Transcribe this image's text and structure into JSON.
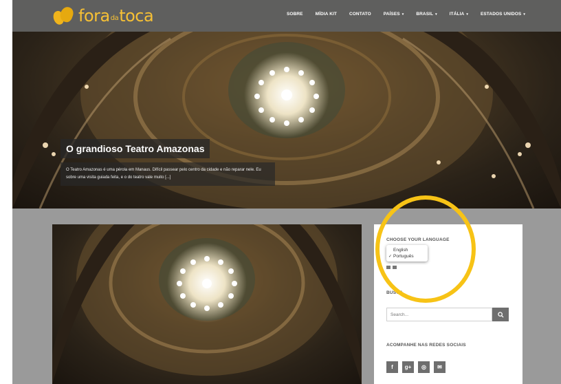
{
  "brand": {
    "logo_text_before": "fora",
    "logo_text_small": "da",
    "logo_text_after": "toca",
    "accent_color": "#f6c035",
    "highlight_color": "#f7c316"
  },
  "nav": {
    "items": [
      {
        "label": "SOBRE",
        "has_dropdown": false
      },
      {
        "label": "MÍDIA KIT",
        "has_dropdown": false
      },
      {
        "label": "CONTATO",
        "has_dropdown": false
      },
      {
        "label": "PAÍSES",
        "has_dropdown": true
      },
      {
        "label": "BRASIL",
        "has_dropdown": true
      },
      {
        "label": "ITÁLIA",
        "has_dropdown": true
      },
      {
        "label": "ESTADOS UNIDOS",
        "has_dropdown": true
      }
    ],
    "caret_icon": "▾"
  },
  "hero": {
    "title": "O grandioso Teatro Amazonas",
    "excerpt": "O Teatro Amazonas é uma pérola em Manaus. Difícil passear pelo centro da cidade e não reparar nele. Eu sobre uma visita guiada feita, e o do teatro vale muito [...]"
  },
  "sidebar": {
    "language_widget": {
      "title": "CHOOSE YOUR LANGUAGE",
      "options": [
        {
          "label": "English",
          "selected": false
        },
        {
          "label": "Português",
          "selected": true
        }
      ],
      "check_glyph": "✓"
    },
    "search_widget": {
      "title": "BUSCA",
      "placeholder": "Search...",
      "button_icon": "search-icon"
    },
    "social_widget": {
      "title": "ACOMPANHE NAS REDES SOCIAIS",
      "buttons": [
        {
          "icon": "facebook-icon",
          "glyph": "f"
        },
        {
          "icon": "google-plus-icon",
          "glyph": "g+"
        },
        {
          "icon": "instagram-icon",
          "glyph": "◎"
        },
        {
          "icon": "email-icon",
          "glyph": "✉"
        }
      ]
    }
  }
}
